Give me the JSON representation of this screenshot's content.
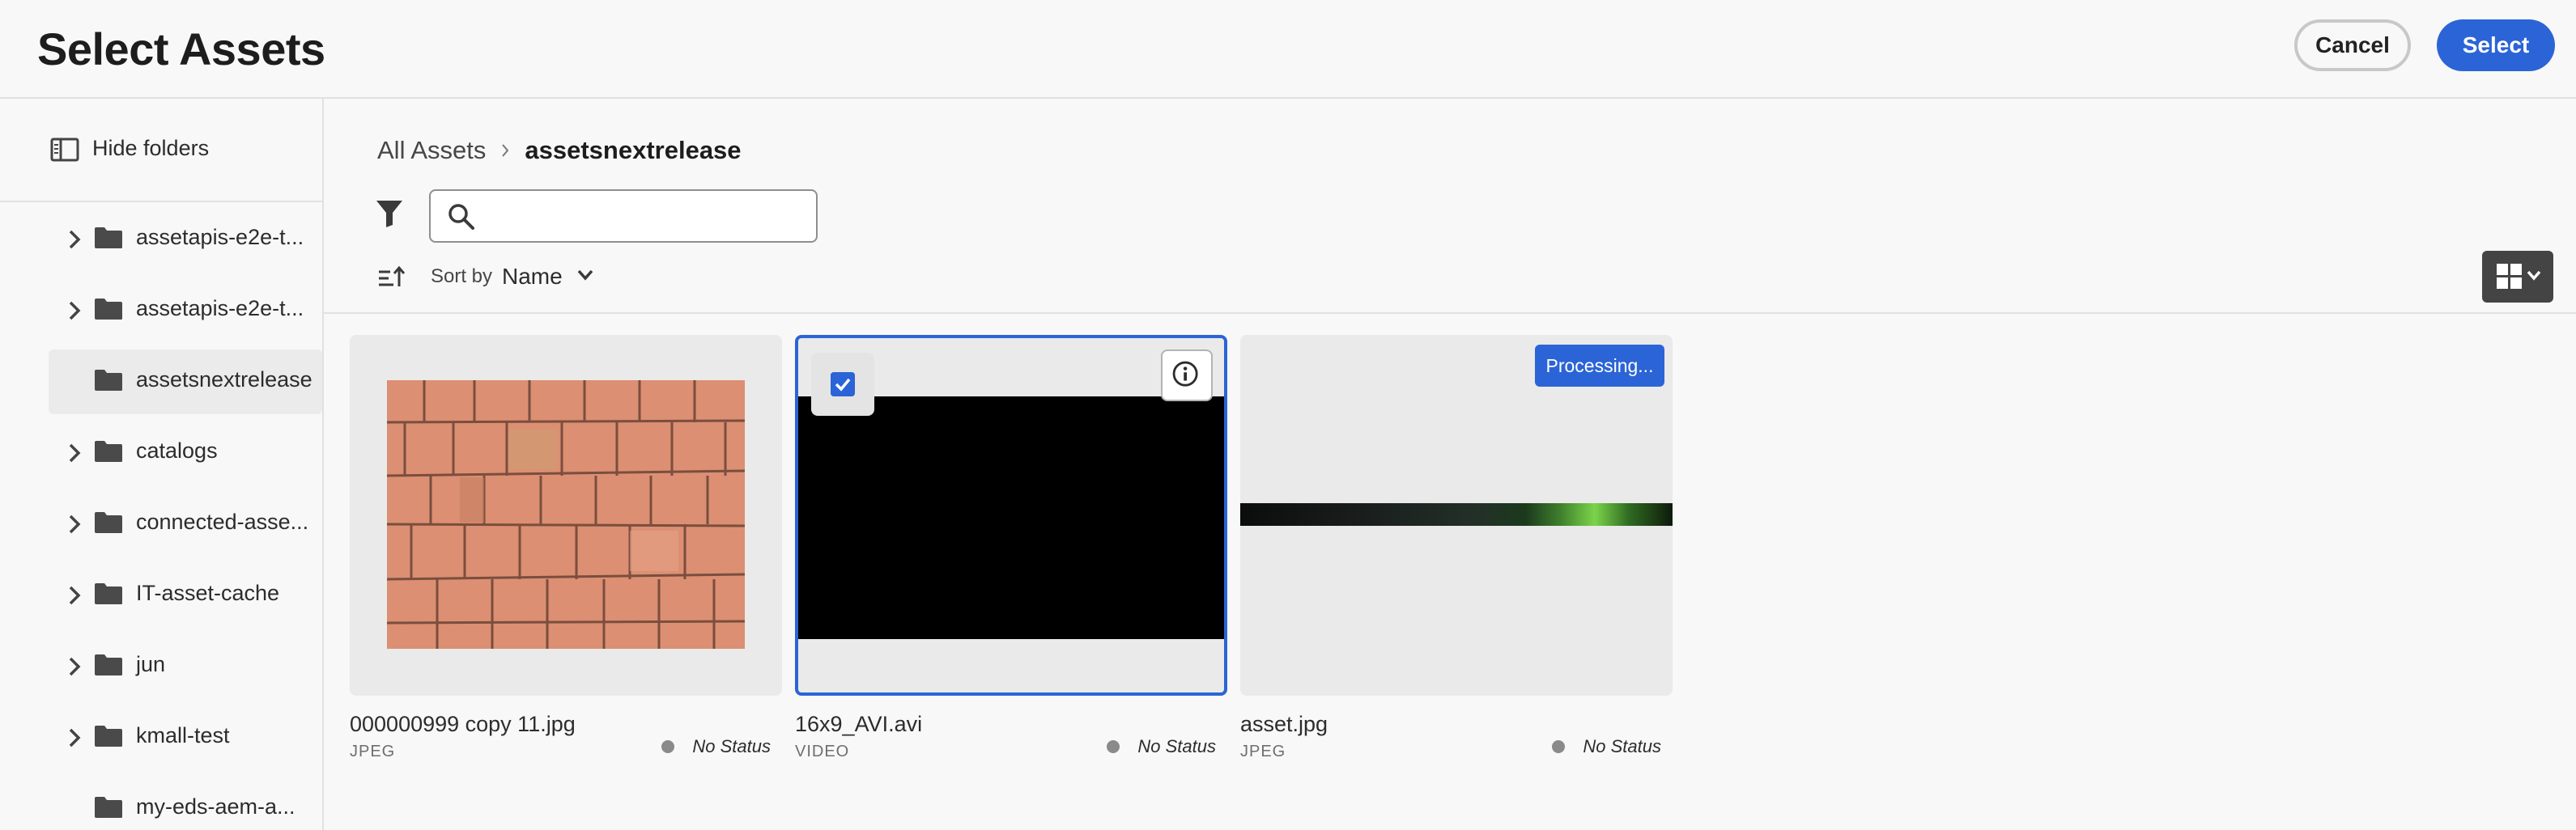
{
  "header": {
    "title": "Select Assets",
    "cancel_label": "Cancel",
    "select_label": "Select"
  },
  "sidebar": {
    "hide_folders_label": "Hide folders",
    "items": [
      {
        "label": "assetapis-e2e-t...",
        "expandable": true,
        "selected": false
      },
      {
        "label": "assetapis-e2e-t...",
        "expandable": true,
        "selected": false
      },
      {
        "label": "assetsnextrelease",
        "expandable": false,
        "selected": true
      },
      {
        "label": "catalogs",
        "expandable": true,
        "selected": false
      },
      {
        "label": "connected-asse...",
        "expandable": true,
        "selected": false
      },
      {
        "label": "IT-asset-cache",
        "expandable": true,
        "selected": false
      },
      {
        "label": "jun",
        "expandable": true,
        "selected": false
      },
      {
        "label": "kmall-test",
        "expandable": true,
        "selected": false
      },
      {
        "label": "my-eds-aem-a...",
        "expandable": false,
        "selected": false
      }
    ]
  },
  "breadcrumb": {
    "root": "All Assets",
    "current": "assetsnextrelease"
  },
  "search": {
    "value": "",
    "placeholder": ""
  },
  "sort": {
    "label": "Sort by",
    "value": "Name"
  },
  "cards": [
    {
      "name": "000000999 copy 11.jpg",
      "type": "JPEG",
      "status": "No Status",
      "selected": false
    },
    {
      "name": "16x9_AVI.avi",
      "type": "VIDEO",
      "status": "No Status",
      "selected": true
    },
    {
      "name": "asset.jpg",
      "type": "JPEG",
      "status": "No Status",
      "selected": false,
      "badge": "Processing..."
    }
  ],
  "colors": {
    "accent": "#2b64d6",
    "status_dot": "#8a8a8a",
    "background": "#f8f8f8"
  }
}
